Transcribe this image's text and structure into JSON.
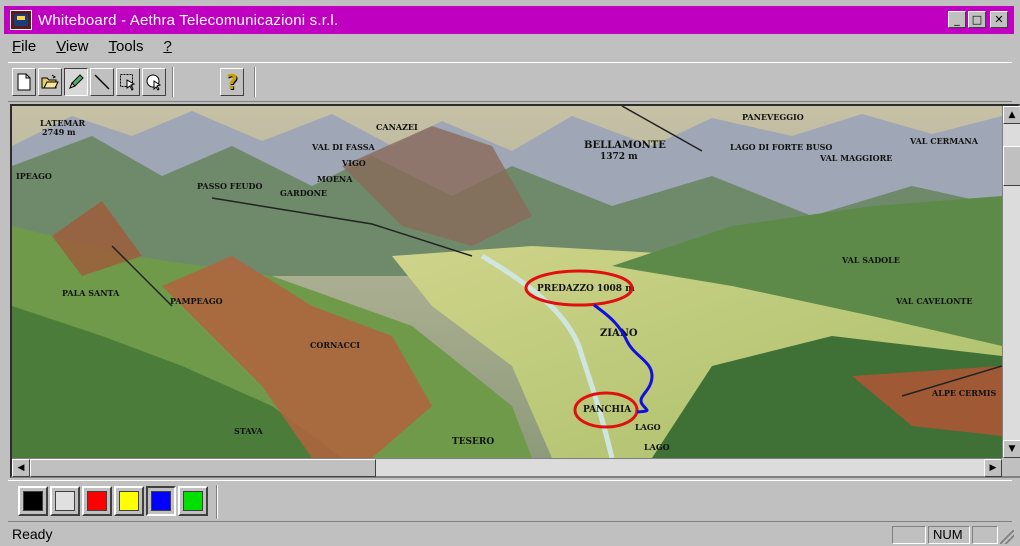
{
  "window": {
    "title": "Whiteboard - Aethra Telecomunicazioni s.r.l.",
    "controls": {
      "minimize": "_",
      "maximize": "□",
      "close": "✕"
    },
    "title_color": "#c000c0"
  },
  "menu": {
    "items": [
      {
        "label": "File",
        "underline": "F",
        "rest": "ile"
      },
      {
        "label": "View",
        "underline": "V",
        "rest": "iew"
      },
      {
        "label": "Tools",
        "underline": "T",
        "rest": "ools"
      },
      {
        "label": "?",
        "underline": "?",
        "rest": ""
      }
    ]
  },
  "toolbar": {
    "tools": [
      {
        "icon": "new-document-icon",
        "glyph": "🗋"
      },
      {
        "icon": "open-folder-icon",
        "glyph": "📂"
      },
      {
        "icon": "pencil-icon",
        "glyph": "✎",
        "pressed": true
      },
      {
        "icon": "line-icon",
        "glyph": "╲"
      },
      {
        "icon": "select-pointer-icon",
        "glyph": "⬚"
      },
      {
        "icon": "zoom-icon",
        "glyph": "◎"
      }
    ],
    "help": {
      "icon": "help-icon",
      "glyph": "?"
    }
  },
  "map": {
    "labels": {
      "latemar": "LATEMAR",
      "latemar_alt": "2749 m",
      "ipeago": "IPEAGO",
      "val_di_fassa": "VAL DI FASSA",
      "canazei": "CANAZEI",
      "vigo": "VIGO",
      "moena": "MOENA",
      "passo_feudo": "PASSO FEUDO",
      "gardone": "GARDONE",
      "bellamonte": "BELLAMONTE",
      "bellamonte_alt": "1372 m",
      "paneveggio": "PANEVEGGIO",
      "val_cermana": "VAL CERMANA",
      "lago_di_forte_buso": "LAGO DI FORTE BUSO",
      "val_maggiore": "VAL MAGGIORE",
      "val_sadole": "VAL SADOLE",
      "val_cavelonte": "VAL CAVELONTE",
      "predazzo": "PREDAZZO 1008 m",
      "ziano": "ZIANO",
      "panchia": "PANCHIA",
      "tesero": "TESERO",
      "lago": "LAGO",
      "cermis": "ALPE CERMIS",
      "pampeago": "PAMPEAGO",
      "pala_santa": "PALA SANTA",
      "cornacci": "CORNACCI",
      "stava": "STAVA",
      "lagorai": "LAGO"
    },
    "annotations": {
      "ellipse_color": "#e01010",
      "route_color": "#1010e0"
    }
  },
  "palette": {
    "colors": [
      "#000000",
      "#e0e0e0",
      "#ff0000",
      "#ffff00",
      "#0000ff",
      "#00e000"
    ],
    "selected_index": 4
  },
  "status": {
    "text": "Ready",
    "panels": [
      "",
      "NUM",
      ""
    ]
  }
}
